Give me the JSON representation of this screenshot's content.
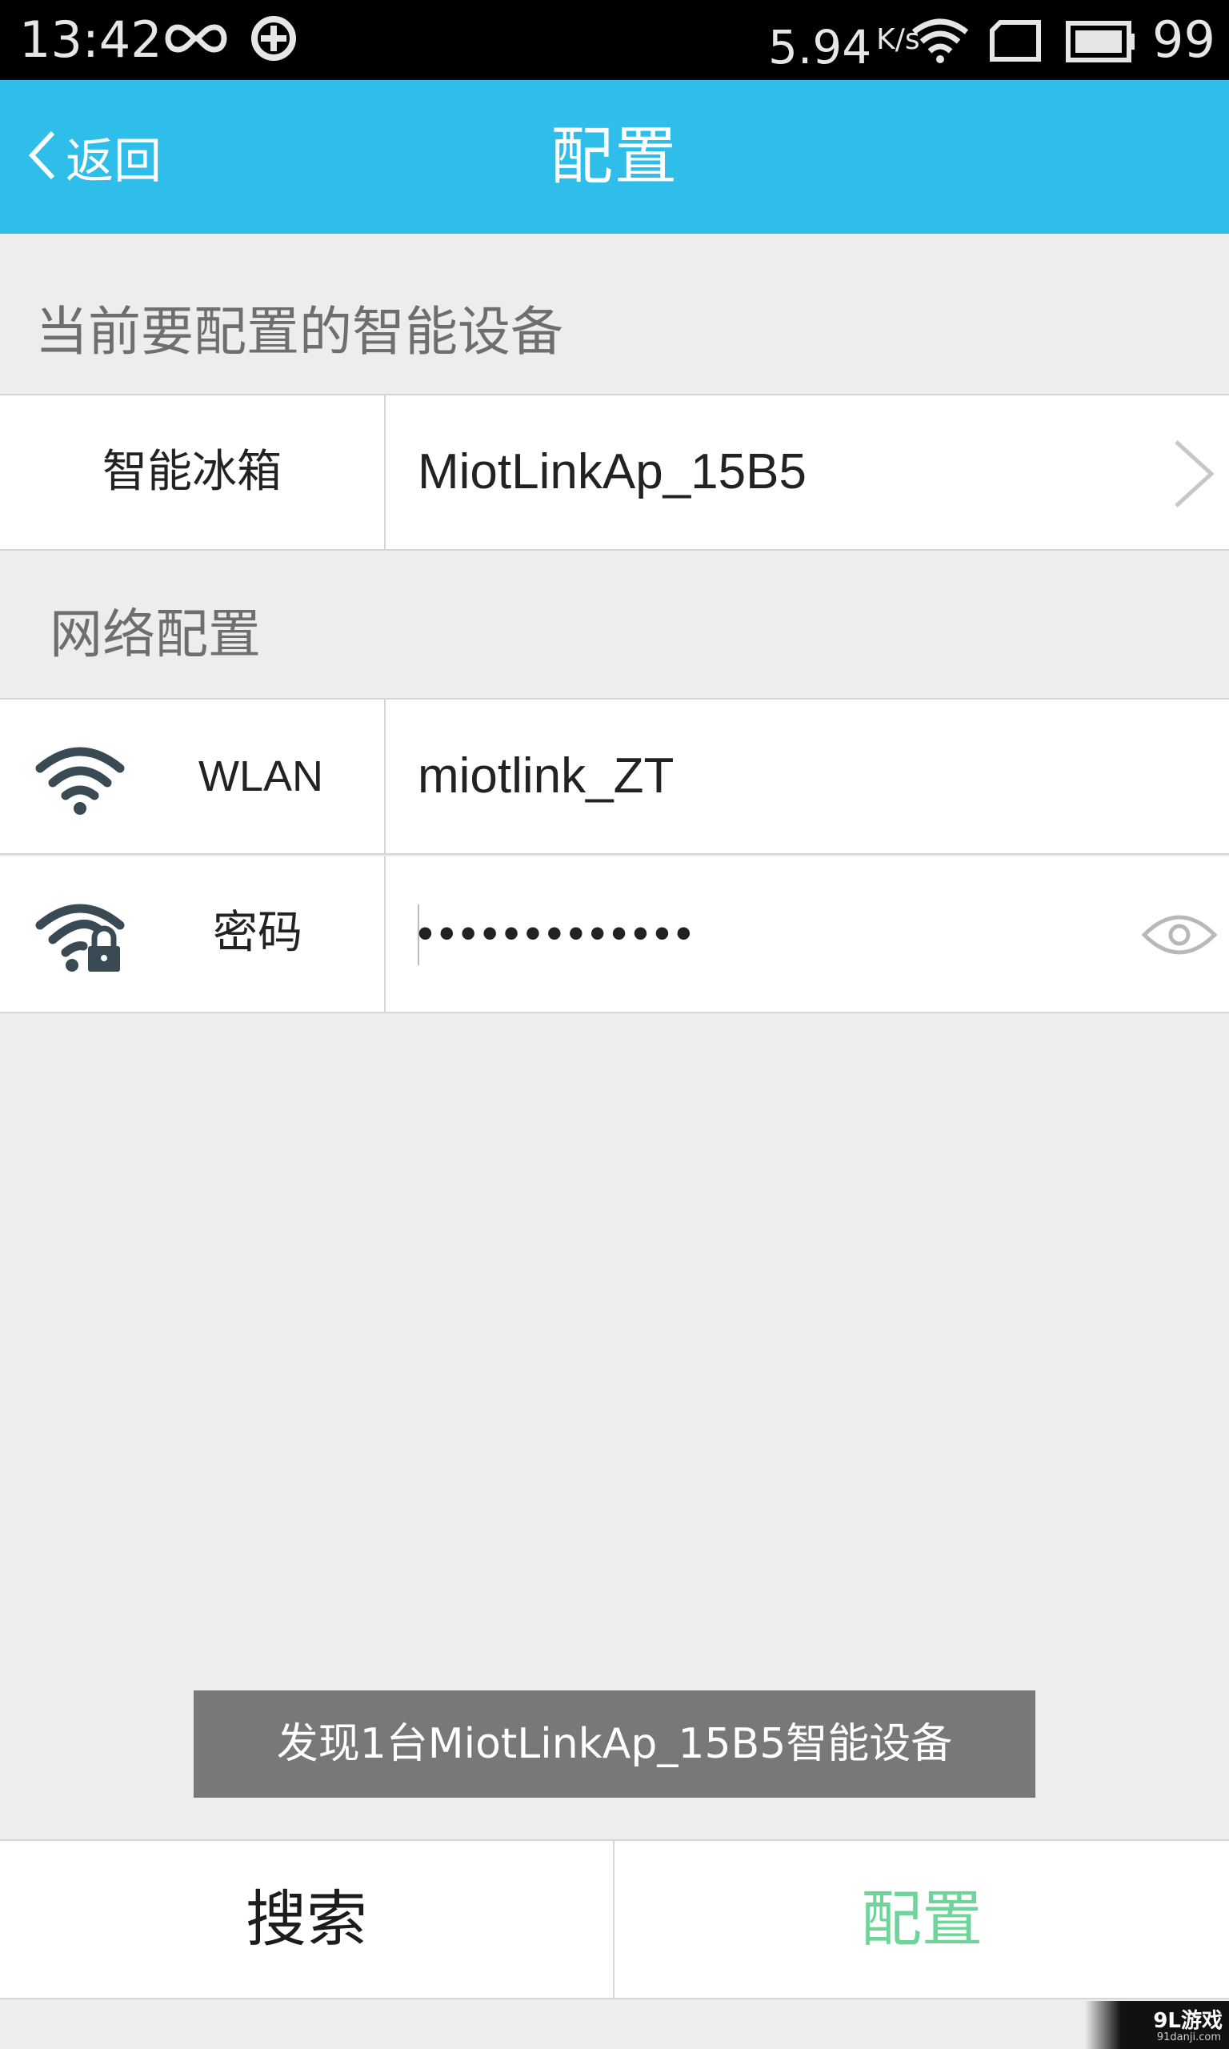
{
  "status_bar": {
    "time": "13:42",
    "net_speed": "5.94",
    "net_speed_unit": "K/s",
    "battery_level": "99",
    "icons": [
      "infinity-icon",
      "sync-icon",
      "wifi-icon",
      "sim-icon",
      "battery-icon"
    ]
  },
  "header": {
    "back_label": "返回",
    "title": "配置",
    "background": "#2fbde9"
  },
  "device_section": {
    "heading": "当前要配置的智能设备",
    "device_type": "智能冰箱",
    "device_name": "MiotLinkAp_15B5"
  },
  "network_section": {
    "heading": "网络配置",
    "wlan_label": "WLAN",
    "wlan_value": "miotlink_ZT",
    "password_label": "密码",
    "password_masked": "•••••••••••••"
  },
  "toast": {
    "message": "发现1台MiotLinkAp_15B5智能设备"
  },
  "bottom_bar": {
    "search_label": "搜索",
    "config_label": "配置",
    "config_color": "#6fd39a"
  },
  "watermark": {
    "main": "9L游戏",
    "sub": "91danji.com"
  }
}
